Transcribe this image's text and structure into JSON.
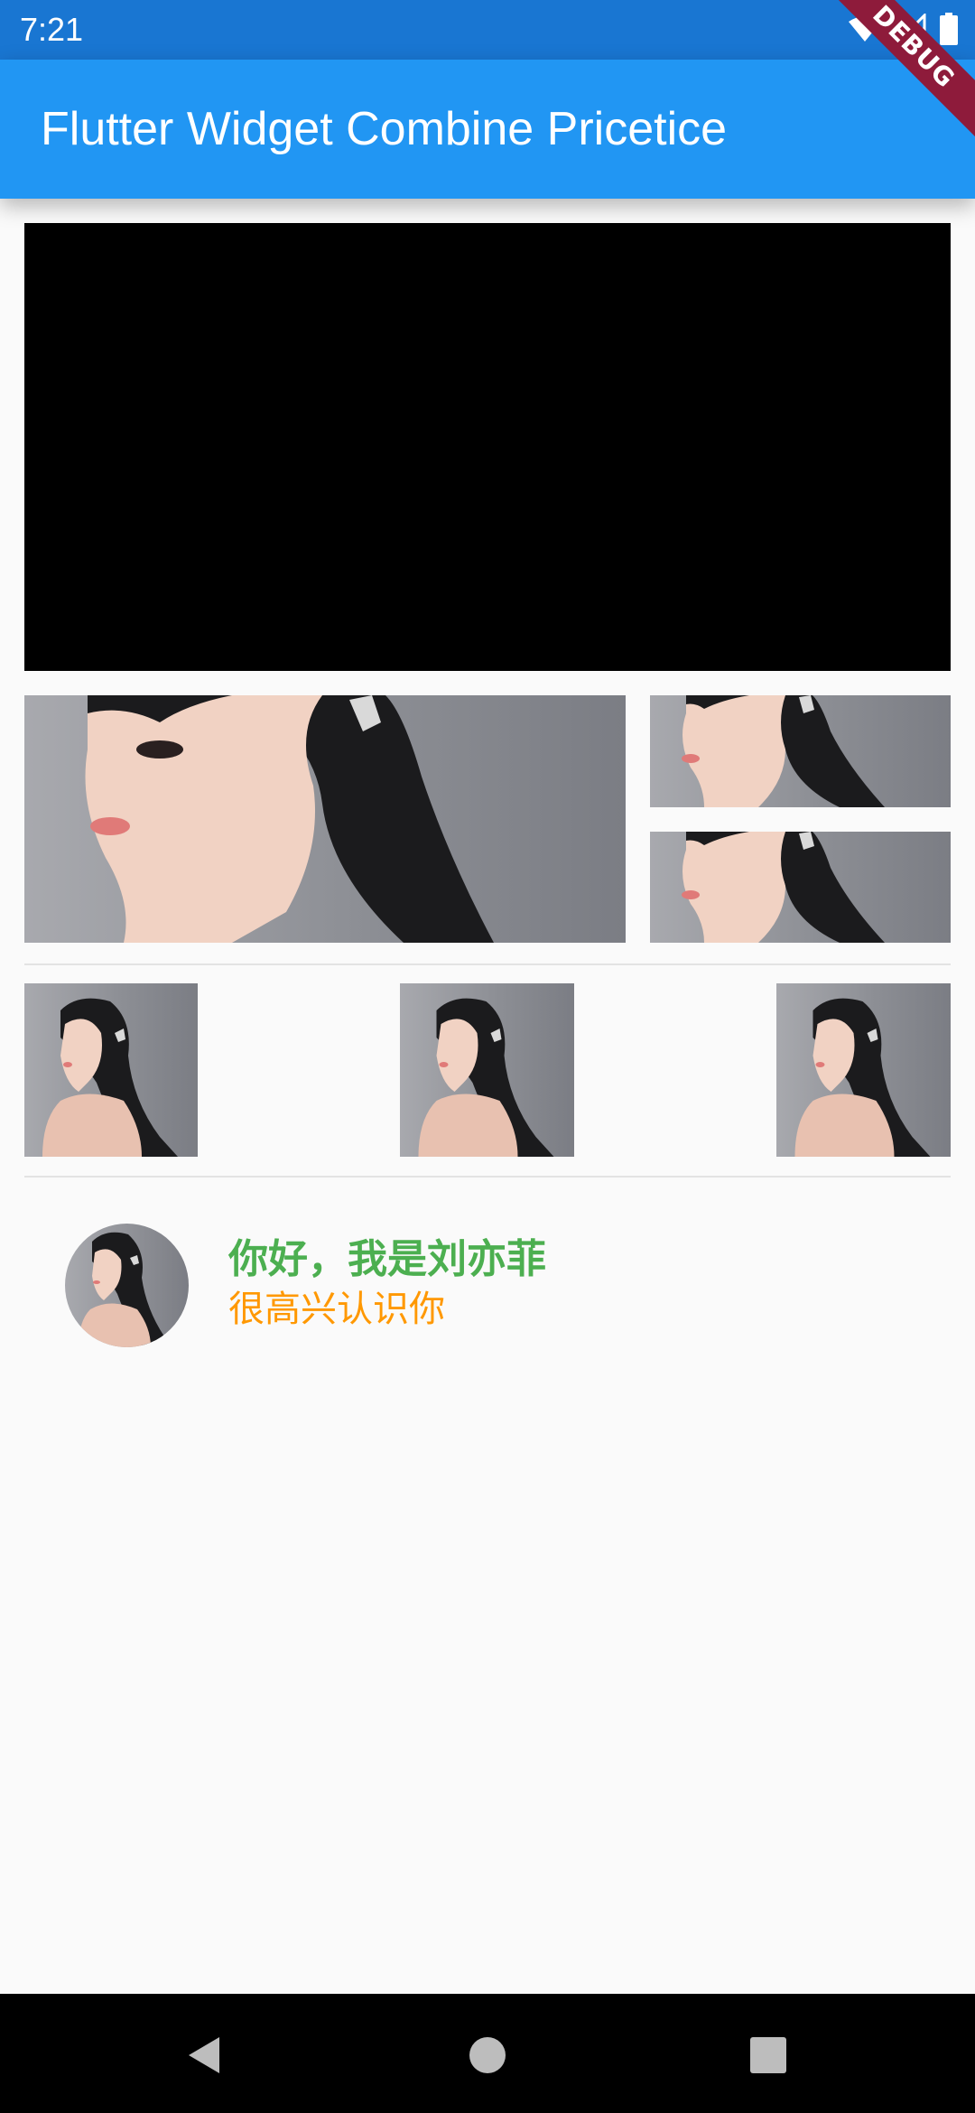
{
  "status_bar": {
    "time": "7:21",
    "icons": [
      "wifi-icon",
      "cell-signal-icon",
      "battery-icon"
    ]
  },
  "app_bar": {
    "title": "Flutter Widget Combine Pricetice",
    "color": "#2196f3",
    "debug_banner": "DEBUG"
  },
  "profile": {
    "greeting": "你好，我是刘亦菲",
    "subtitle": "很高兴认识你",
    "greeting_color": "#4caf50",
    "subtitle_color": "#ff9800"
  },
  "nav_bar": {
    "buttons": [
      "back-triangle-icon",
      "home-circle-icon",
      "recents-square-icon"
    ]
  }
}
